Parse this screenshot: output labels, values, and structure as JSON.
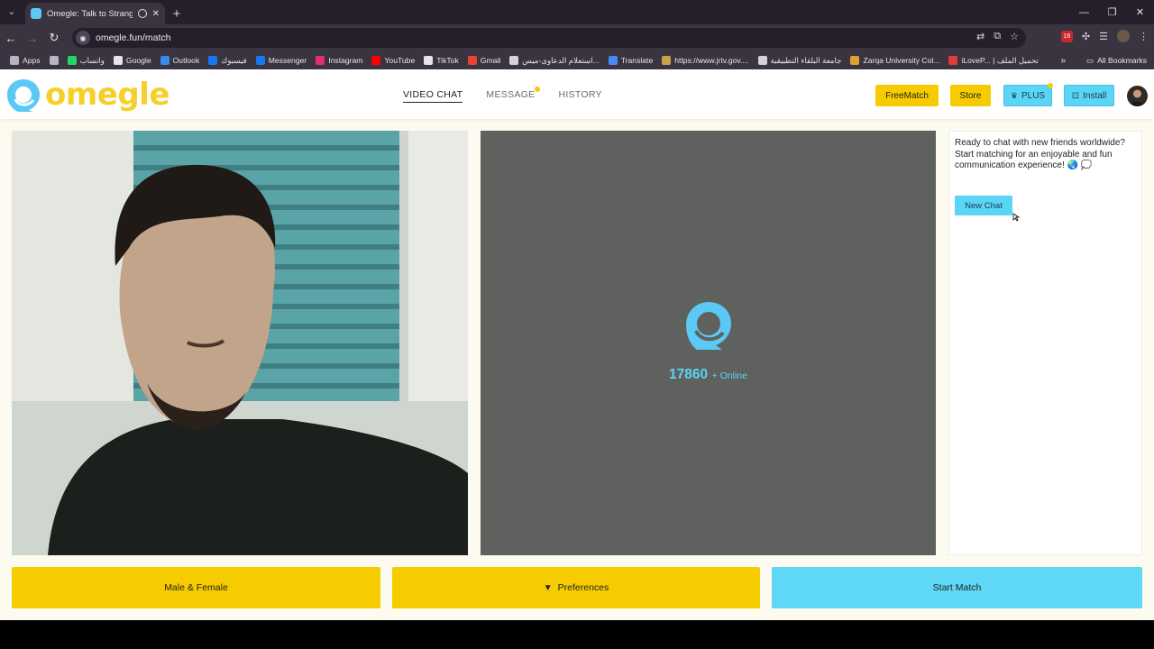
{
  "browser": {
    "tab_title": "Omegle: Talk to Strangers v",
    "url": "omegle.fun/match",
    "ext_badge": "16",
    "bookmarks": [
      {
        "label": "Apps",
        "icon": "apps-grid-icon",
        "color": "#b9b2c2"
      },
      {
        "label": "",
        "icon": "grid-icon",
        "color": "#b9b2c2"
      },
      {
        "label": "واتساب",
        "icon": "whatsapp-icon",
        "color": "#25d366"
      },
      {
        "label": "Google",
        "icon": "google-icon",
        "color": "#e8e4ee"
      },
      {
        "label": "Outlook",
        "icon": "outlook-icon",
        "color": "#3a8be8"
      },
      {
        "label": "فيسبوك",
        "icon": "facebook-icon",
        "color": "#1877f2"
      },
      {
        "label": "Messenger",
        "icon": "facebook-icon",
        "color": "#1877f2"
      },
      {
        "label": "Instagram",
        "icon": "instagram-icon",
        "color": "#e1306c"
      },
      {
        "label": "YouTube",
        "icon": "youtube-icon",
        "color": "#ff0000"
      },
      {
        "label": "TikTok",
        "icon": "tiktok-icon",
        "color": "#e8e4ee"
      },
      {
        "label": "Gmail",
        "icon": "gmail-icon",
        "color": "#ea4335"
      },
      {
        "label": "استعلام الدعاوى-ميس...",
        "icon": "gear-icon",
        "color": "#d6d2dc"
      },
      {
        "label": "Translate",
        "icon": "translate-icon",
        "color": "#4a8af4"
      },
      {
        "label": "https://www.jrtv.gov....",
        "icon": "crown-icon",
        "color": "#c9a14a"
      },
      {
        "label": "جامعة البلقاء التطبيقية",
        "icon": "globe-icon",
        "color": "#d6d2dc"
      },
      {
        "label": "Zarqa University Col...",
        "icon": "university-icon",
        "color": "#e0a030"
      },
      {
        "label": "iLoveP... | تحميل الملف",
        "icon": "heart-icon",
        "color": "#e23b3b"
      }
    ],
    "all_bookmarks": "All Bookmarks"
  },
  "header": {
    "logo_text": "omegle",
    "nav": [
      {
        "label": "VIDEO CHAT",
        "active": true
      },
      {
        "label": "MESSAGE",
        "active": false
      },
      {
        "label": "HISTORY",
        "active": false
      }
    ],
    "buttons": {
      "freematch": "FreeMatch",
      "store": "Store",
      "plus": "PLUS",
      "install": "Install"
    }
  },
  "partner": {
    "online_count": "17860",
    "online_label": "+ Online"
  },
  "chat": {
    "message": "Ready to chat with new friends worldwide? Start matching for an enjoyable and fun communication experience! 🌏 💭",
    "new_chat": "New Chat"
  },
  "bottom": {
    "gender": "Male & Female",
    "preferences": "Preferences",
    "start": "Start Match"
  },
  "colors": {
    "brand_yellow": "#f6cc00",
    "brand_blue": "#5bd5f5",
    "page_bg": "#fdfbef"
  }
}
